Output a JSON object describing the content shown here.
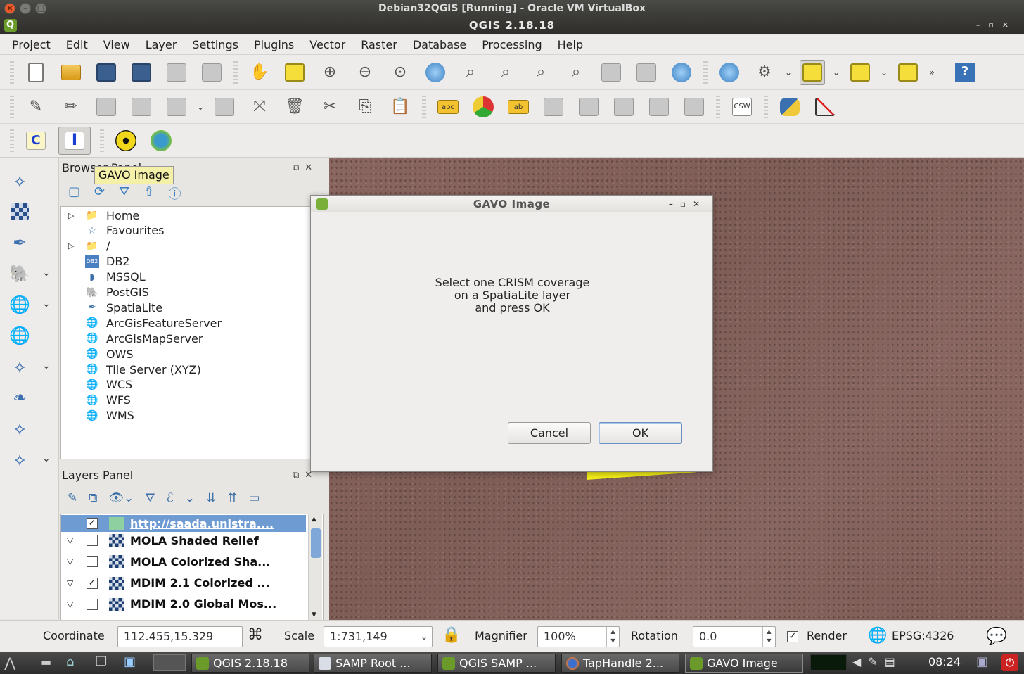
{
  "vbox": {
    "title": "Debian32QGIS [Running] - Oracle VM VirtualBox"
  },
  "qgis": {
    "title": "QGIS 2.18.18"
  },
  "menu": [
    "Project",
    "Edit",
    "View",
    "Layer",
    "Settings",
    "Plugins",
    "Vector",
    "Raster",
    "Database",
    "Processing",
    "Help"
  ],
  "toolbar3": {
    "c_label": "C",
    "i_label": "I"
  },
  "tooltip": "GAVO Image",
  "browser": {
    "title": "Browser Panel",
    "items": [
      {
        "label": "Home",
        "icon": "folder-icon",
        "expandable": true
      },
      {
        "label": "Favourites",
        "icon": "star-icon",
        "expandable": false
      },
      {
        "label": "/",
        "icon": "folder-icon",
        "expandable": true
      },
      {
        "label": "DB2",
        "icon": "db2-icon",
        "expandable": false
      },
      {
        "label": "MSSQL",
        "icon": "mssql-icon",
        "expandable": false
      },
      {
        "label": "PostGIS",
        "icon": "postgis-icon",
        "expandable": false
      },
      {
        "label": "SpatiaLite",
        "icon": "spatialite-icon",
        "expandable": false
      },
      {
        "label": "ArcGisFeatureServer",
        "icon": "globe-icon",
        "expandable": false
      },
      {
        "label": "ArcGisMapServer",
        "icon": "globe-icon",
        "expandable": false
      },
      {
        "label": "OWS",
        "icon": "globe-icon",
        "expandable": false
      },
      {
        "label": "Tile Server (XYZ)",
        "icon": "globe-icon",
        "expandable": false
      },
      {
        "label": "WCS",
        "icon": "globe-icon",
        "expandable": false
      },
      {
        "label": "WFS",
        "icon": "globe-icon",
        "expandable": false
      },
      {
        "label": "WMS",
        "icon": "globe-icon",
        "expandable": false
      }
    ]
  },
  "layers": {
    "title": "Layers Panel",
    "items": [
      {
        "name": "http://saada.unistra....",
        "checked": true,
        "selected": true
      },
      {
        "name": "MOLA Shaded Relief",
        "checked": false,
        "selected": false
      },
      {
        "name": "MOLA Colorized Sha...",
        "checked": false,
        "selected": false
      },
      {
        "name": "MDIM 2.1 Colorized ...",
        "checked": true,
        "selected": false
      },
      {
        "name": "MDIM 2.0 Global Mos...",
        "checked": false,
        "selected": false
      }
    ]
  },
  "dialog": {
    "title": "GAVO Image",
    "message": [
      "Select one CRISM coverage",
      "on a SpatiaLite layer",
      "and press OK"
    ],
    "cancel": "Cancel",
    "ok": "OK"
  },
  "status": {
    "coordinate_label": "Coordinate",
    "coordinate_value": "112.455,15.329",
    "scale_label": "Scale",
    "scale_value": "1:731,149",
    "magnifier_label": "Magnifier",
    "magnifier_value": "100%",
    "rotation_label": "Rotation",
    "rotation_value": "0.0",
    "render_label": "Render",
    "render_checked": true,
    "crs": "EPSG:4326"
  },
  "taskbar": {
    "tasks": [
      "QGIS 2.18.18",
      "SAMP Root ...",
      "QGIS SAMP ...",
      "TapHandle 2...",
      "GAVO Image"
    ],
    "clock": "08:24"
  }
}
